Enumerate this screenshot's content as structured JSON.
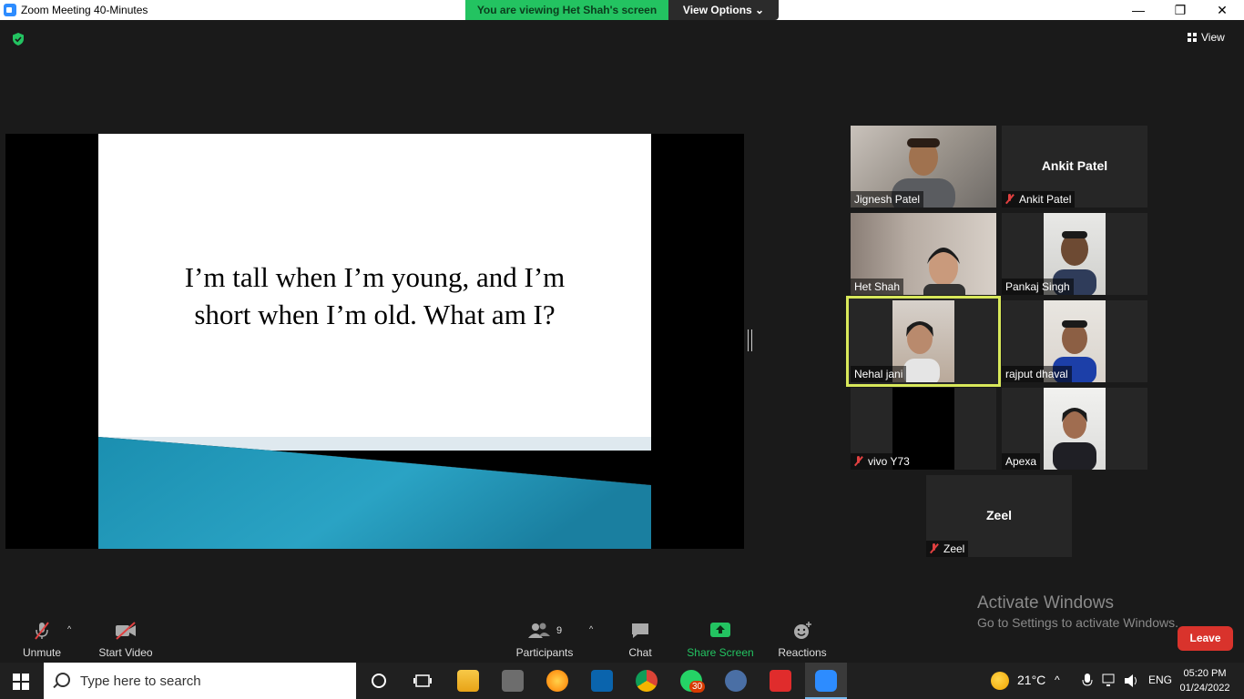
{
  "window": {
    "title": "Zoom Meeting 40-Minutes",
    "minimize": "—",
    "maximize": "❐",
    "close": "✕"
  },
  "banner": {
    "viewing": "You are viewing Het Shah's screen",
    "view_options": "View Options ⌄"
  },
  "header": {
    "view_label": "View"
  },
  "slide": {
    "line1": "I’m tall when I’m young, and I’m",
    "line2": "short when I’m old. What am I?"
  },
  "participants_tiles": [
    {
      "name": "Jignesh Patel",
      "muted": false,
      "video": true
    },
    {
      "name": "Ankit Patel",
      "muted": true,
      "video": false
    },
    {
      "name": "Het Shah",
      "muted": false,
      "video": true
    },
    {
      "name": "Pankaj Singh",
      "muted": false,
      "video": true
    },
    {
      "name": "Nehal jani",
      "muted": false,
      "video": true,
      "active_speaker": true
    },
    {
      "name": "rajput dhaval",
      "muted": false,
      "video": true
    },
    {
      "name": "vivo Y73",
      "muted": true,
      "video": true
    },
    {
      "name": "Apexa",
      "muted": false,
      "video": true
    },
    {
      "name": "Zeel",
      "muted": true,
      "video": false
    }
  ],
  "watermark": {
    "line1": "Activate Windows",
    "line2": "Go to Settings to activate Windows."
  },
  "toolbar": {
    "unmute": "Unmute",
    "start_video": "Start Video",
    "participants": "Participants",
    "participants_count": "9",
    "chat": "Chat",
    "share_screen": "Share Screen",
    "reactions": "Reactions",
    "leave": "Leave"
  },
  "taskbar": {
    "search_placeholder": "Type here to search",
    "whatsapp_badge": "30",
    "weather": "21°C",
    "language": "ENG",
    "time": "05:20 PM",
    "date": "01/24/2022"
  },
  "colors": {
    "accent_green": "#23c361",
    "leave_red": "#d9332c",
    "active_outline": "#d8e85a",
    "zoom_blue": "#2d8cff"
  }
}
